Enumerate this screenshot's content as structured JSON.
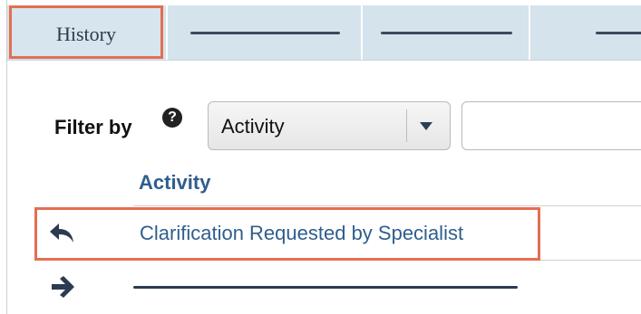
{
  "tabs": {
    "active_label": "History"
  },
  "filter": {
    "label": "Filter by",
    "help_icon_glyph": "?",
    "select_value": "Activity",
    "text_value": ""
  },
  "table": {
    "column_header": "Activity",
    "rows": [
      {
        "icon": "reply-arrow-icon",
        "activity": "Clarification Requested by Specialist"
      },
      {
        "icon": "right-arrow-icon",
        "activity": ""
      }
    ]
  },
  "colors": {
    "highlight": "#e46e52",
    "tab_strip": "#d4e3ec",
    "link": "#2f5e8e"
  }
}
